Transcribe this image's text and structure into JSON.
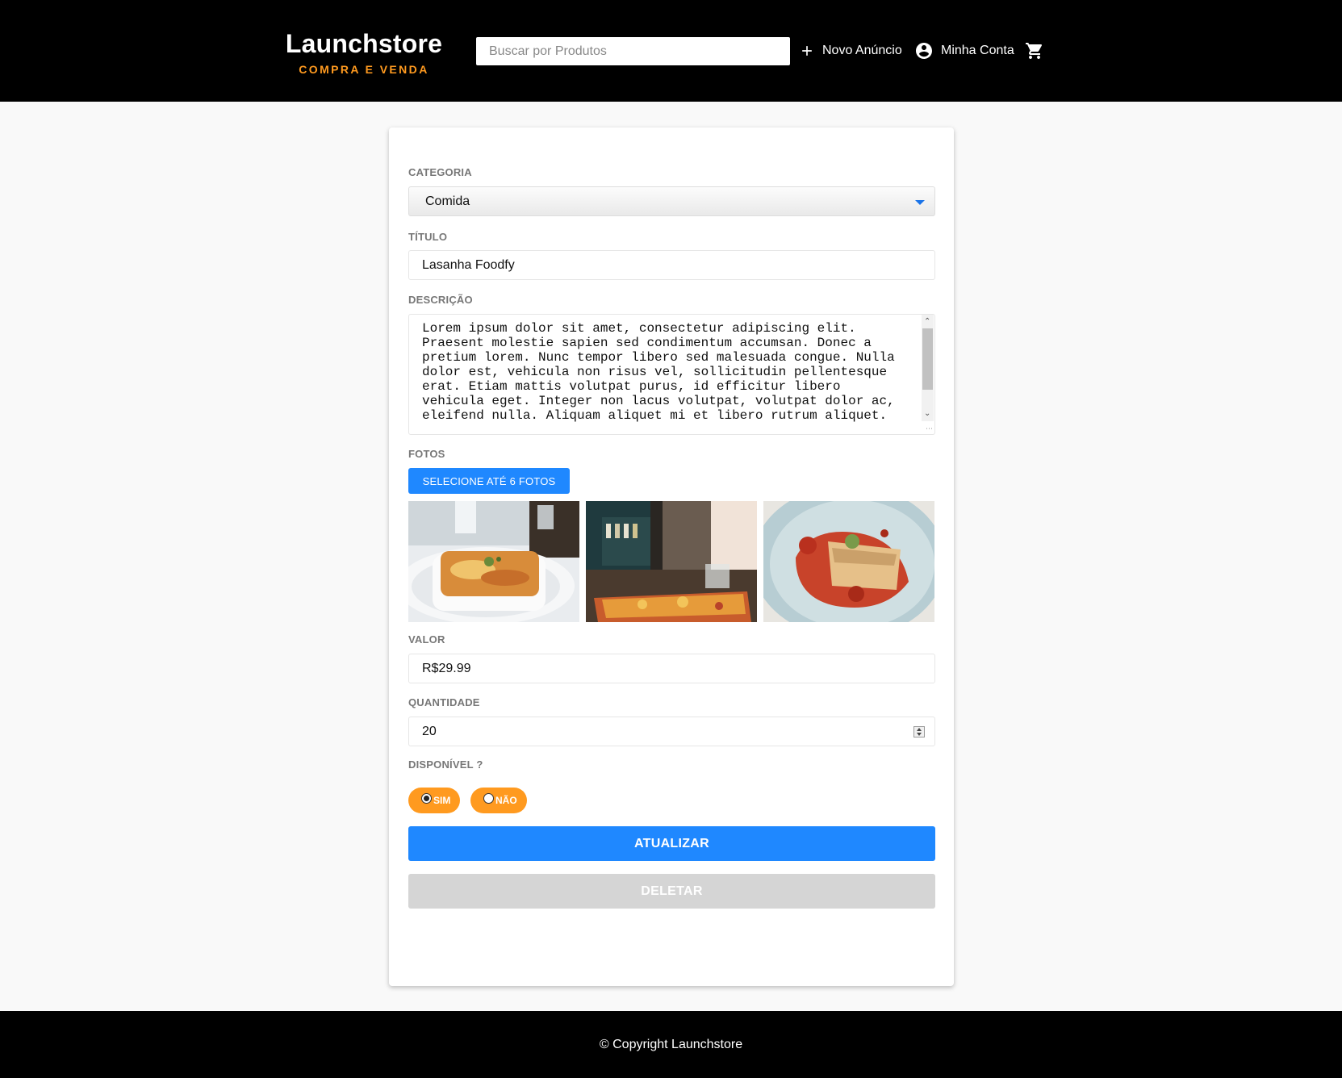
{
  "header": {
    "logo_title": "Launchstore",
    "logo_subtitle": "COMPRA E VENDA",
    "search_placeholder": "Buscar por Produtos",
    "new_ad_label": "Novo Anúncio",
    "account_label": "Minha Conta",
    "accent_color": "#ff9a1f"
  },
  "form": {
    "category": {
      "label": "Categoria",
      "value": "Comida"
    },
    "title": {
      "label": "Título",
      "value": "Lasanha Foodfy"
    },
    "description": {
      "label": "Descrição",
      "value": "Lorem ipsum dolor sit amet, consectetur adipiscing elit. Praesent molestie sapien sed condimentum accumsan. Donec a pretium lorem. Nunc tempor libero sed malesuada congue. Nulla dolor est, vehicula non risus vel, sollicitudin pellentesque erat. Etiam mattis volutpat purus, id efficitur libero vehicula eget. Integer non lacus volutpat, volutpat dolor ac, eleifend nulla. Aliquam aliquet mi et libero rutrum aliquet."
    },
    "photos": {
      "label": "Fotos",
      "button_label": "Selecione até 6 fotos",
      "items": [
        "lasagna-dish-photo",
        "lasagna-tray-photo",
        "lasagna-plate-photo"
      ]
    },
    "price": {
      "label": "Valor",
      "value": "R$29.99"
    },
    "quantity": {
      "label": "Quantidade",
      "value": "20"
    },
    "availability": {
      "label": "Disponível ?",
      "options": [
        {
          "label": "SIM",
          "checked": true
        },
        {
          "label": "NÃO",
          "checked": false
        }
      ]
    },
    "update_label": "ATUALIZAR",
    "delete_label": "DELETAR",
    "primary_color": "#1f88ff"
  },
  "footer": {
    "text": "© Copyright Launchstore"
  }
}
